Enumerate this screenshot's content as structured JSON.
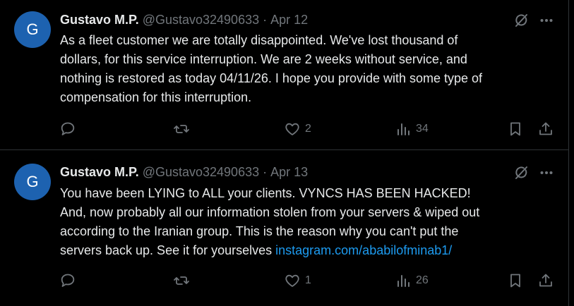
{
  "colors": {
    "background": "#000000",
    "text_primary": "#e7e9ea",
    "text_secondary": "#71767b",
    "link": "#1d9bf0",
    "avatar_bg": "#1d62b0",
    "divider": "#2f3336"
  },
  "tweets": [
    {
      "avatar_letter": "G",
      "name": "Gustavo M.P.",
      "handle": "@Gustavo32490633",
      "separator": "·",
      "date": "Apr 12",
      "lines": [
        "As a fleet customer we are totally disappointed.  We've lost thousand of",
        "dollars, for this service interruption.  We are 2 weeks without service, and",
        "nothing is restored as today 04/11/26.  I hope you provide with some type of",
        "compensation for this interruption."
      ],
      "last_line_prefix": "",
      "link_text": "",
      "likes": "2",
      "views": "34",
      "icons": [
        "grok-icon",
        "more-icon",
        "reply-icon",
        "retweet-icon",
        "like-icon",
        "views-icon",
        "bookmark-icon",
        "share-icon"
      ]
    },
    {
      "avatar_letter": "G",
      "name": "Gustavo M.P.",
      "handle": "@Gustavo32490633",
      "separator": "·",
      "date": "Apr 13",
      "lines": [
        "You have been LYING to ALL your clients.  VYNCS HAS BEEN HACKED!",
        "And, now probably all our information stolen from your servers & wiped out",
        "according to the Iranian group.  This is the reason why you can't put the"
      ],
      "last_line_prefix": "servers back up.  See it for yourselves ",
      "link_text": "instagram.com/ababilofminab1/",
      "likes": "1",
      "views": "26",
      "icons": [
        "grok-icon",
        "more-icon",
        "reply-icon",
        "retweet-icon",
        "like-icon",
        "views-icon",
        "bookmark-icon",
        "share-icon"
      ]
    }
  ]
}
